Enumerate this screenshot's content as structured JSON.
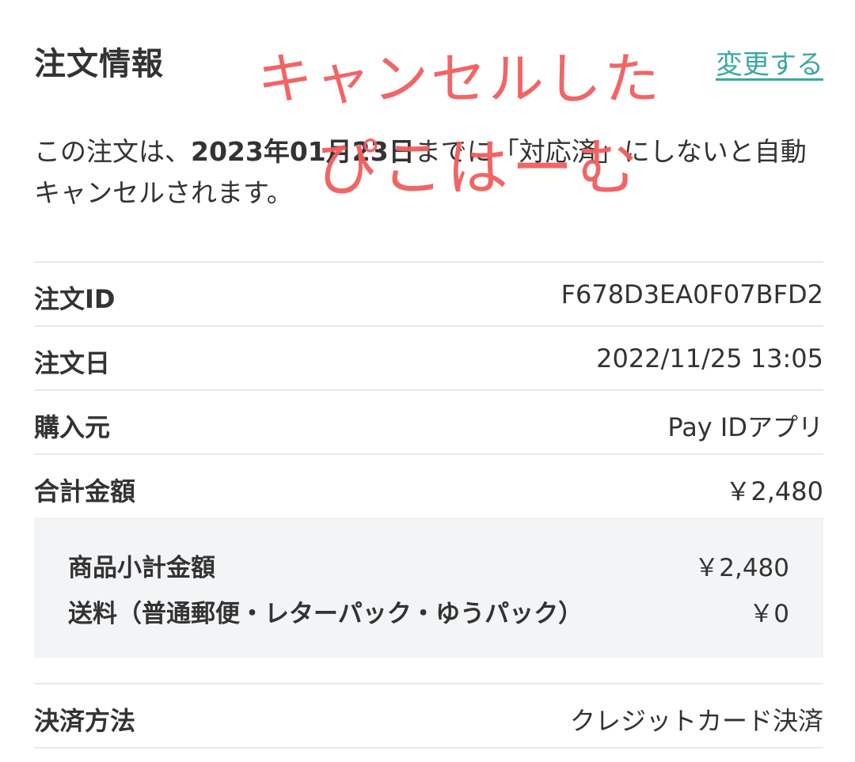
{
  "header": {
    "title": "注文情報",
    "change_label": "変更する"
  },
  "notice": {
    "prefix": "この注文は、",
    "deadline": "2023年01月23日",
    "suffix": "までに「対応済」にしないと自動キャンセルされます。"
  },
  "details": {
    "order_id": {
      "label": "注文ID",
      "value": "F678D3EA0F07BFD2"
    },
    "order_date": {
      "label": "注文日",
      "value": "2022/11/25 13:05"
    },
    "purchase_source": {
      "label": "購入元",
      "value": "Pay IDアプリ"
    },
    "total": {
      "label": "合計金額",
      "value": "￥2,480"
    },
    "breakdown": [
      {
        "label": "商品小計金額",
        "value": "￥2,480"
      },
      {
        "label": "送料（普通郵便・レターパック・ゆうパック）",
        "value": "￥0"
      }
    ],
    "payment_method": {
      "label": "決済方法",
      "value": "クレジットカード決済"
    }
  },
  "annotation": {
    "line1": "キャンセルした",
    "line2": "ぴこはーむ",
    "color": "#f25d5d"
  },
  "colors": {
    "link": "#3aa99f",
    "text": "#333333",
    "divider": "#e9e9e9",
    "breakdown_bg": "#f2f4f6"
  }
}
